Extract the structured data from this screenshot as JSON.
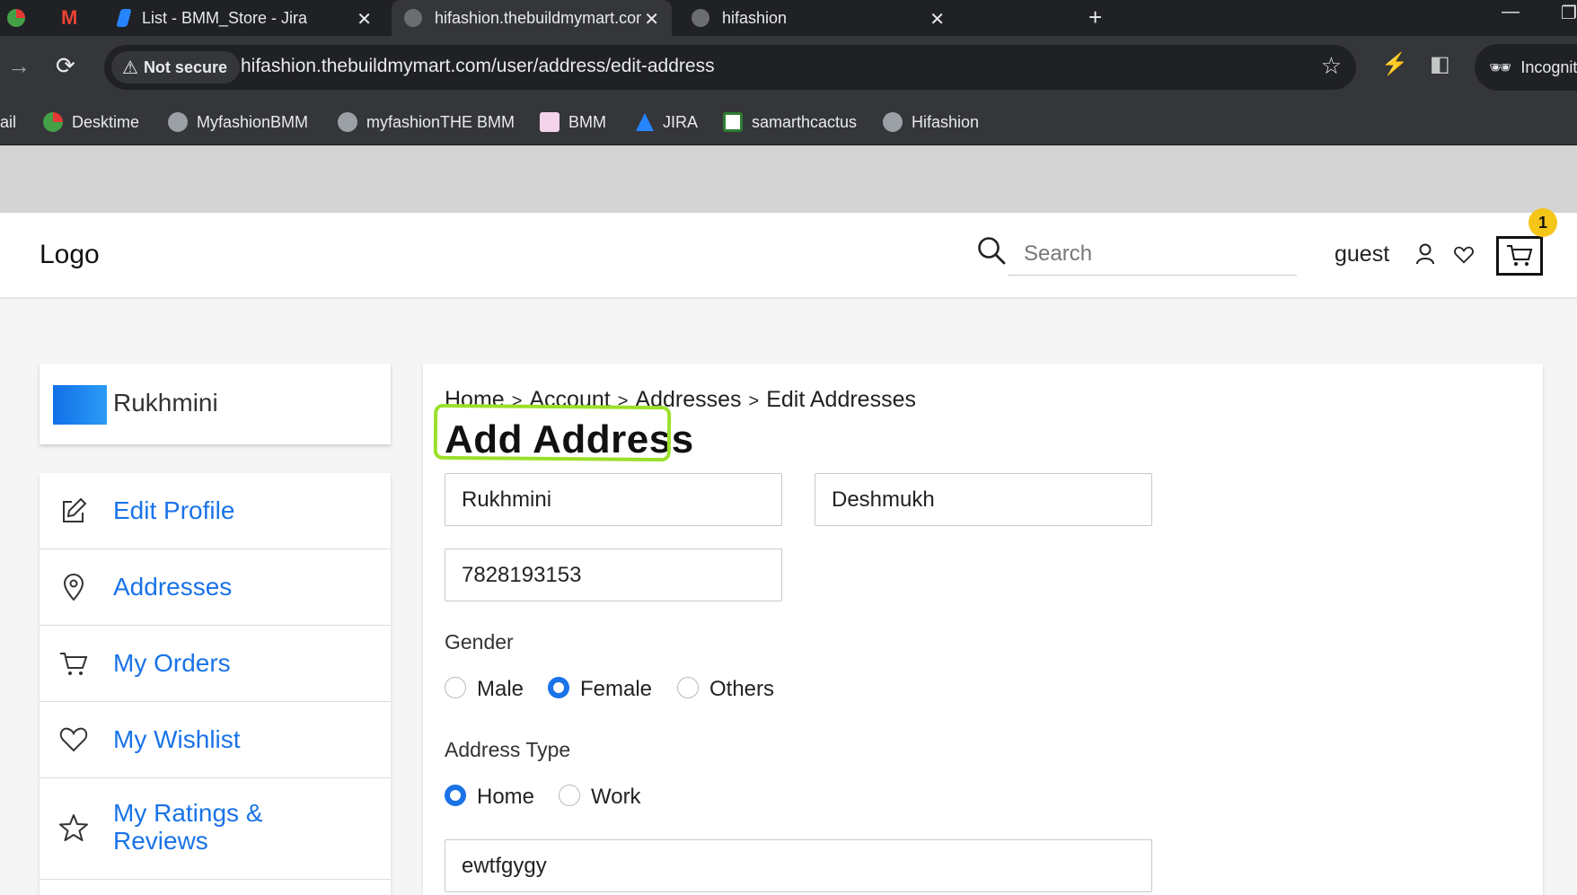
{
  "browser": {
    "tabs": [
      {
        "title": ""
      },
      {
        "title": ""
      },
      {
        "title": "List - BMM_Store - Jira"
      },
      {
        "title": "hifashion.thebuildmymart.com/"
      },
      {
        "title": "hifashion"
      }
    ],
    "security_label": "Not secure",
    "url": "hifashion.thebuildmymart.com/user/address/edit-address",
    "profile_label": "Incognit",
    "bookmarks": [
      {
        "label": "ail"
      },
      {
        "label": "Desktime"
      },
      {
        "label": "MyfashionBMM"
      },
      {
        "label": "myfashionTHE BMM"
      },
      {
        "label": "BMM"
      },
      {
        "label": "JIRA"
      },
      {
        "label": "samarthcactus"
      },
      {
        "label": "Hifashion"
      }
    ]
  },
  "header": {
    "logo": "Logo",
    "search_placeholder": "Search",
    "user_label": "guest",
    "cart_count": "1"
  },
  "sidebar": {
    "profile_name": "Rukhmini",
    "menu": [
      {
        "label": "Edit Profile",
        "icon": "edit-icon"
      },
      {
        "label": "Addresses",
        "icon": "location-pin-icon"
      },
      {
        "label": "My Orders",
        "icon": "cart-icon"
      },
      {
        "label": "My Wishlist",
        "icon": "heart-icon"
      },
      {
        "label": "My Ratings &",
        "label2": "Reviews",
        "icon": "star-icon"
      }
    ]
  },
  "main": {
    "breadcrumb": [
      "Home",
      "Account",
      "Addresses",
      "Edit Addresses"
    ],
    "breadcrumb_sep": ">",
    "title": "Add Address",
    "first_name": "Rukhmini",
    "last_name": "Deshmukh",
    "phone": "7828193153",
    "gender_label": "Gender",
    "gender_options": [
      "Male",
      "Female",
      "Others"
    ],
    "gender_selected": "Female",
    "address_type_label": "Address Type",
    "address_type_options": [
      "Home",
      "Work"
    ],
    "address_type_selected": "Home",
    "address_line": "ewtfgygy"
  },
  "colors": {
    "link_blue": "#1a73e8",
    "highlight_green": "#9be02a",
    "badge_yellow": "#f5c518"
  }
}
